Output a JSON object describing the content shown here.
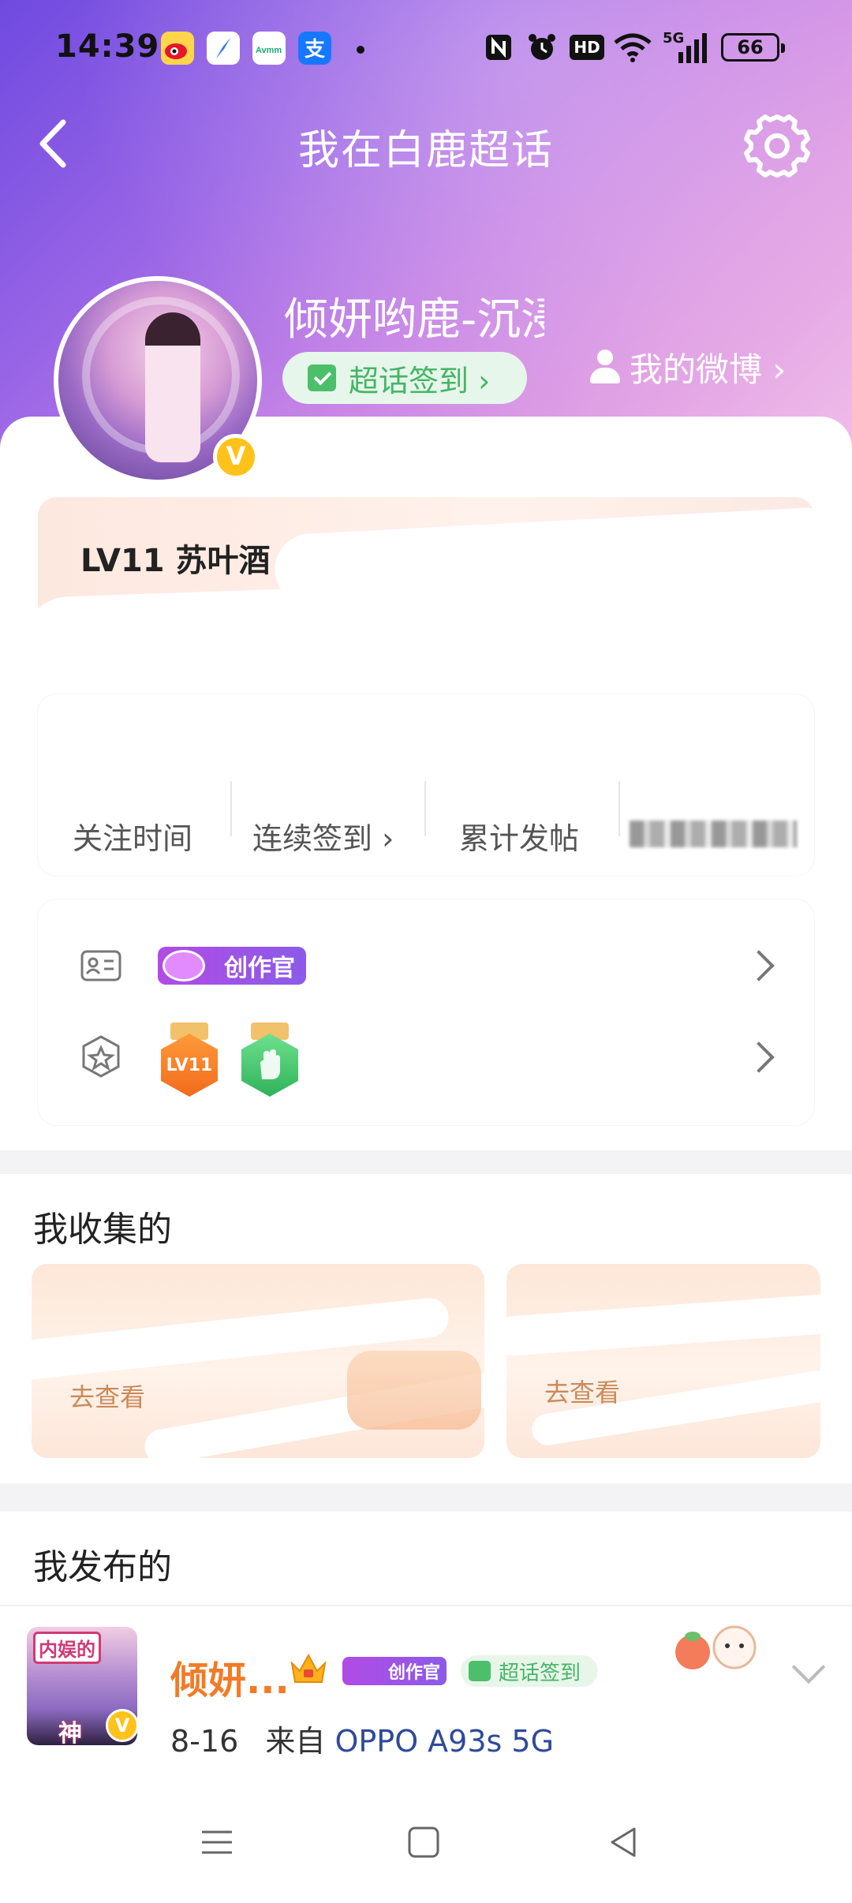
{
  "status_bar": {
    "time": "14:39",
    "app_icons": [
      "weibo-icon",
      "compass-icon",
      "avmm-icon",
      "alipay-icon"
    ],
    "right_icons": [
      "nfc-icon",
      "alarm-icon",
      "hd-icon",
      "wifi-icon",
      "5g-signal-icon"
    ],
    "hd": "HD",
    "net": "5G",
    "battery": "66"
  },
  "header": {
    "title": "我在白鹿超话"
  },
  "profile": {
    "username": "倾妍哟鹿-沉浸",
    "checkin_label": "超话签到 ›",
    "my_weibo_label": "我的微博 ›"
  },
  "level": {
    "label": "LV11 苏叶酒"
  },
  "stats": {
    "follow_time": "关注时间",
    "streak": "连续签到 ›",
    "posts": "累计发帖"
  },
  "badges": {
    "creator_tag": "创作官",
    "lv_medal": "LV11"
  },
  "collections": {
    "title": "我收集的",
    "card1_link": "去查看",
    "card2_link": "去查看"
  },
  "posts": {
    "title": "我发布的",
    "item": {
      "avatar_tag1": "内娱的",
      "avatar_tag2": "神",
      "name": "倾妍...",
      "creator_tag": "创作官",
      "checkin_tag": "超话签到",
      "date": "8-16",
      "source_prefix": "来自",
      "device": "OPPO A93s 5G"
    }
  },
  "colors": {
    "accent": "#f17b27",
    "checkin_green": "#45b566",
    "verify_gold": "#ffc21a",
    "creator_purple": "#a152e7"
  }
}
